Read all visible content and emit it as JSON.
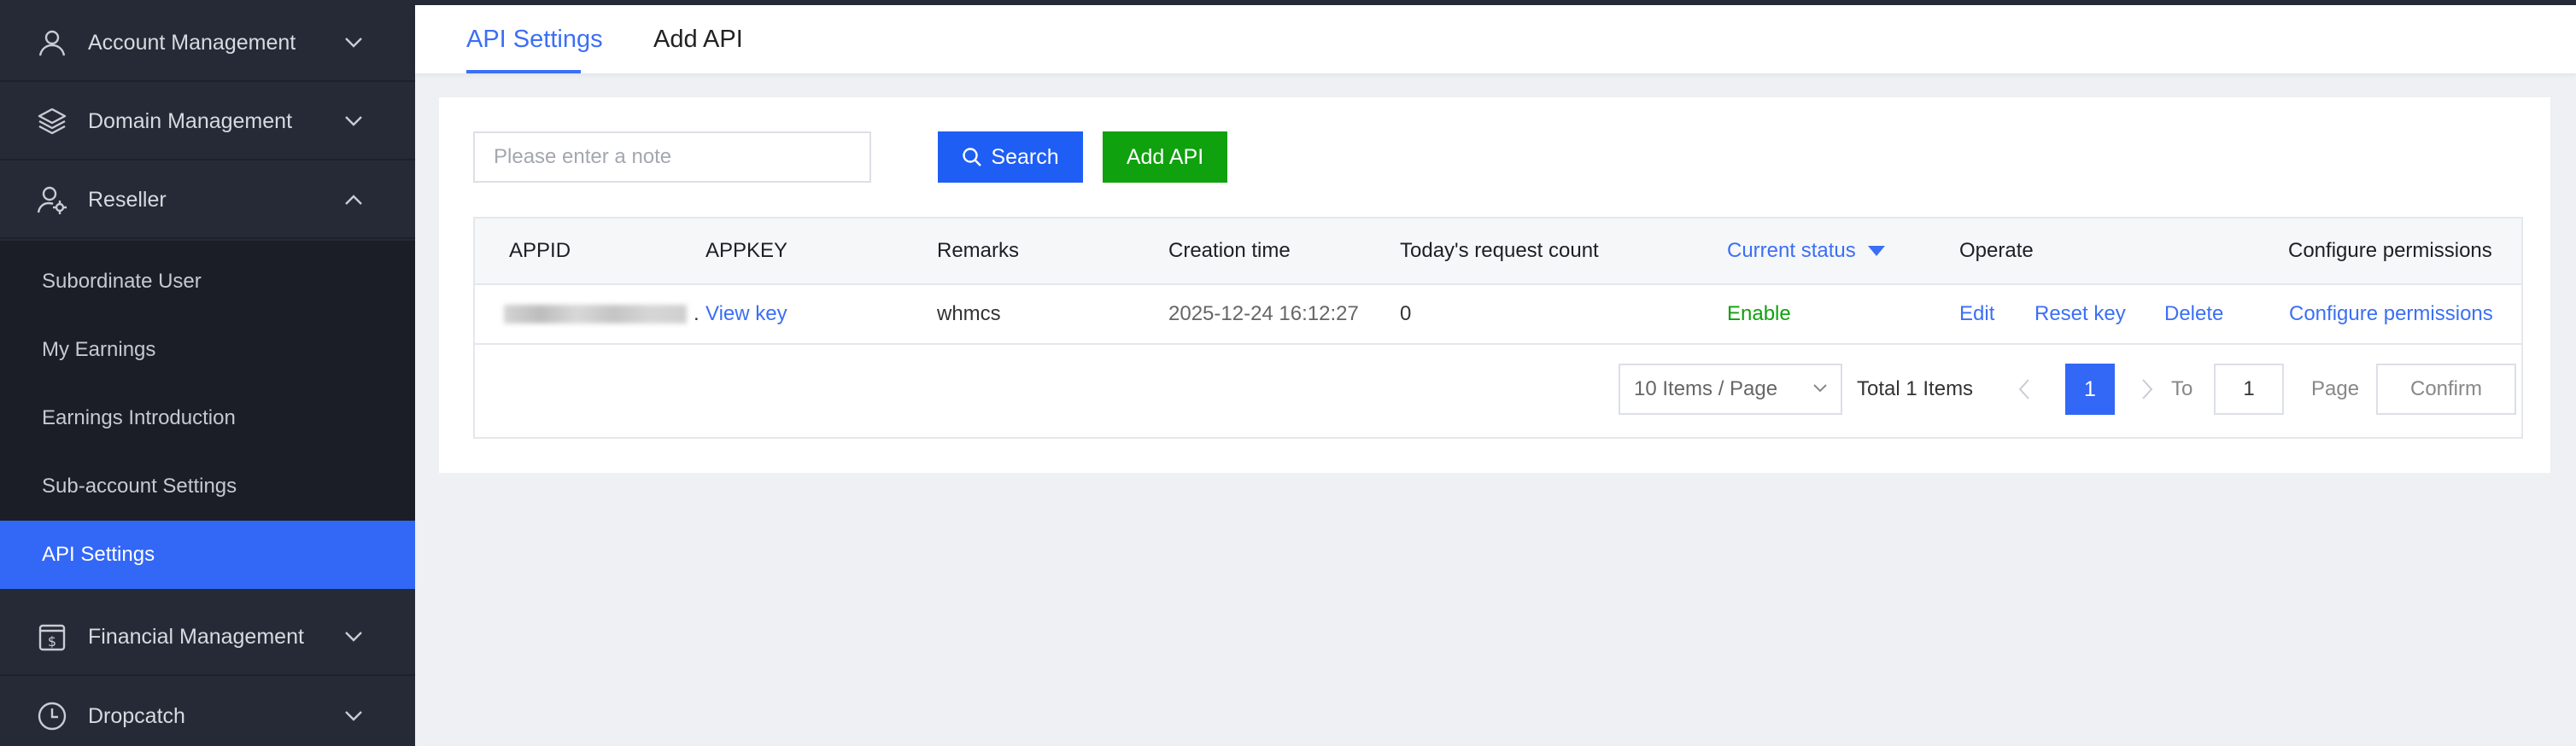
{
  "sidebar": {
    "account_management": "Account Management",
    "domain_management": "Domain Management",
    "reseller": "Reseller",
    "reseller_items": {
      "subordinate_user": "Subordinate User",
      "my_earnings": "My Earnings",
      "earnings_introduction": "Earnings Introduction",
      "subaccount_settings": "Sub-account Settings",
      "api_settings": "API Settings"
    },
    "financial_management": "Financial Management",
    "dropcatch": "Dropcatch"
  },
  "tabs": {
    "api_settings": "API Settings",
    "add_api": "Add API"
  },
  "toolbar": {
    "note_placeholder": "Please enter a note",
    "search_label": "Search",
    "add_api_label": "Add API"
  },
  "table": {
    "columns": {
      "appid": "APPID",
      "appkey": "APPKEY",
      "remarks": "Remarks",
      "creation_time": "Creation time",
      "request_count": "Today's request count",
      "current_status": "Current status",
      "operate": "Operate",
      "configure_permissions": "Configure permissions"
    },
    "rows": [
      {
        "appid_suffix": ".",
        "appkey_link": "View key",
        "remarks": "whmcs",
        "creation_time": "2025-12-24 16:12:27",
        "request_count": "0",
        "status": "Enable",
        "op_edit": "Edit",
        "op_reset_key": "Reset key",
        "op_delete": "Delete",
        "configure_permissions": "Configure permissions"
      }
    ]
  },
  "pagination": {
    "page_size": "10 Items / Page",
    "total": "Total 1 Items",
    "current_page": "1",
    "to_label": "To",
    "goto_value": "1",
    "page_label": "Page",
    "confirm_label": "Confirm"
  },
  "colors": {
    "accent": "#3367f6",
    "link": "#3b6ff5",
    "add_button": "#10a10e",
    "status_enable": "#10a10e",
    "sidebar_bg": "#262a36"
  }
}
